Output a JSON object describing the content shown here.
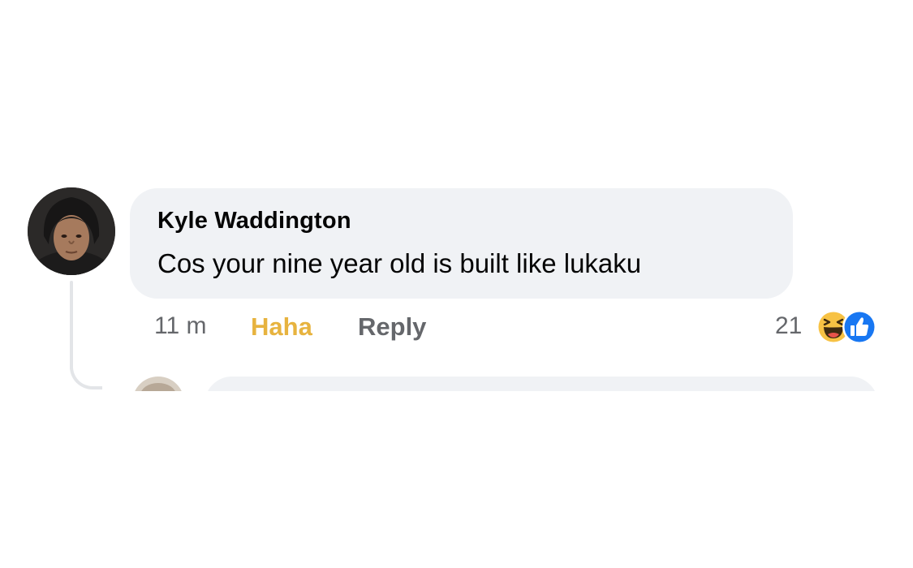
{
  "comment": {
    "author": "Kyle Waddington",
    "text": "Cos your nine year old is built like lukaku",
    "time": "11 m",
    "reacted_label": "Haha",
    "reply_label": "Reply",
    "reaction_count": "21",
    "reaction_icons": [
      "haha-emoji-icon",
      "like-icon"
    ]
  },
  "colors": {
    "bubble": "#f0f2f5",
    "text_primary": "#050505",
    "text_secondary": "#65676b",
    "haha_accent": "#e7b33f",
    "like_blue": "#1877f2"
  }
}
